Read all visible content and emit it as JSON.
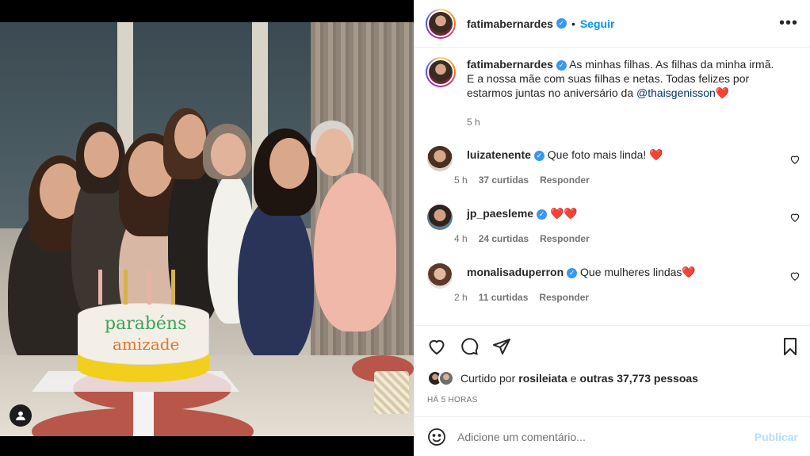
{
  "post": {
    "username": "fatimabernardes",
    "follow_label": "Seguir",
    "more_label": "•••",
    "separator": "•",
    "caption": "As minhas filhas. As filhas da minha irmã. E a nossa mãe com suas filhas e netas. Todas felizes por estarmos juntas no aniversário da",
    "caption_mention": "@thaisgenisson",
    "caption_time": "5 h"
  },
  "photo": {
    "cake_line1": "parabéns",
    "cake_line2": "amizade"
  },
  "comments": [
    {
      "username": "luizatenente",
      "text": "Que foto mais linda! ❤️",
      "time": "5 h",
      "likes": "37 curtidas",
      "reply": "Responder"
    },
    {
      "username": "jp_paesleme",
      "text": "❤️❤️",
      "time": "4 h",
      "likes": "24 curtidas",
      "reply": "Responder"
    },
    {
      "username": "monalisaduperron",
      "text": "Que mulheres lindas❤️",
      "time": "2 h",
      "likes": "11 curtidas",
      "reply": "Responder"
    }
  ],
  "likes": {
    "prefix": "Curtido por",
    "user": "rosileiata",
    "middle": "e",
    "others": "outras 37,773 pessoas"
  },
  "posted_ago": "HÁ 5 HORAS",
  "add_comment": {
    "placeholder": "Adicione um comentário...",
    "publish_label": "Publicar"
  },
  "colors": {
    "link": "#0095f6",
    "publish_disabled": "#b2dffc",
    "verified": "#3897f0",
    "heart": "#e0245e"
  }
}
